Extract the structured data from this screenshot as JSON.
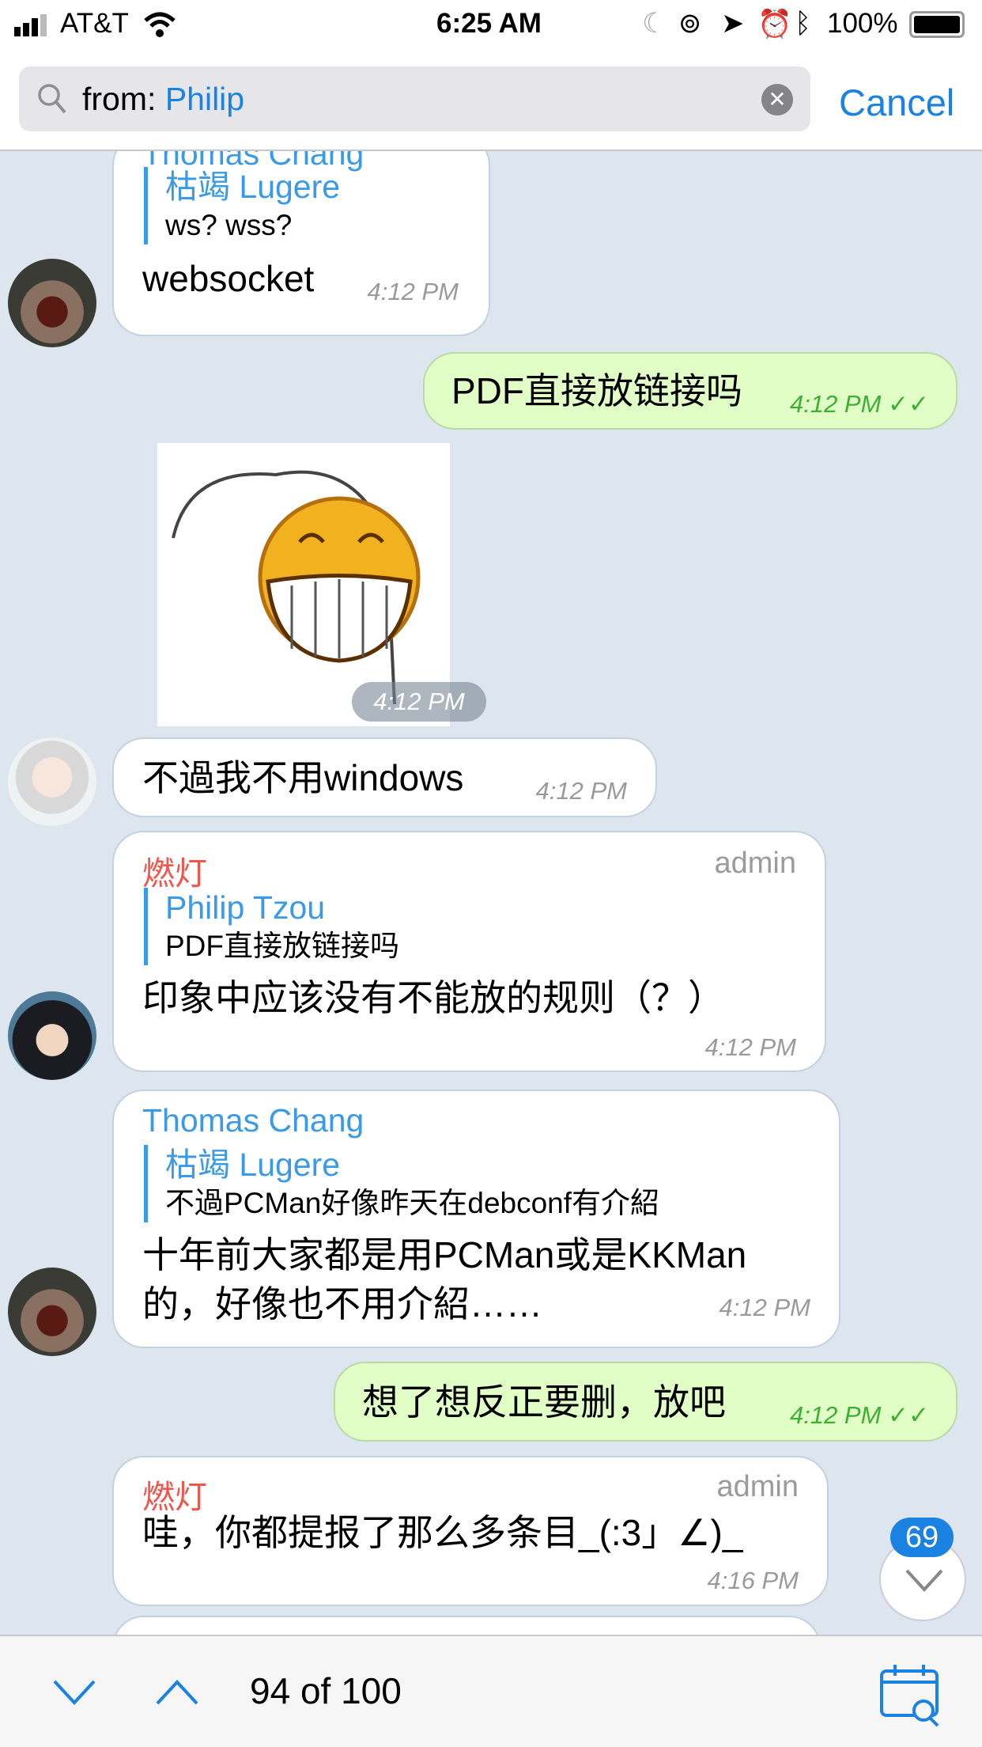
{
  "status_bar": {
    "carrier": "AT&T",
    "time": "6:25 AM",
    "battery": "100%",
    "icons": [
      "signal-icon",
      "wifi-icon",
      "moon-icon",
      "rotation-lock-icon",
      "location-icon",
      "alarm-icon",
      "bluetooth-icon",
      "battery-icon"
    ]
  },
  "search": {
    "prefix": "from:",
    "query": "Philip",
    "cancel": "Cancel"
  },
  "messages": [
    {
      "sender": "Thomas Chang",
      "reply_name": "枯竭 Lugere",
      "reply_text": "ws? wss?",
      "text": "websocket",
      "time": "4:12 PM"
    },
    {
      "text": "PDF直接放链接吗",
      "time": "4:12 PM",
      "outgoing": true
    },
    {
      "sticker": "grinning-face-sticker",
      "time": "4:12 PM"
    },
    {
      "text": "不過我不用windows",
      "time": "4:12 PM"
    },
    {
      "sender": "燃灯",
      "role": "admin",
      "reply_name": "Philip Tzou",
      "reply_text": "PDF直接放链接吗",
      "text": "印象中应该没有不能放的规则（？）",
      "time": "4:12 PM"
    },
    {
      "sender": "Thomas Chang",
      "reply_name": "枯竭 Lugere",
      "reply_text": "不過PCMan好像昨天在debconf有介紹",
      "text": "十年前大家都是用PCMan或是KKMan",
      "text2": "的，好像也不用介紹……",
      "time": "4:12 PM"
    },
    {
      "text": "想了想反正要删，放吧",
      "time": "4:12 PM",
      "outgoing": true
    },
    {
      "sender": "燃灯",
      "role": "admin",
      "text": "哇，你都提报了那么多条目_(:3」∠)_",
      "time": "4:16 PM"
    }
  ],
  "scroll_badge": "69",
  "bottom_bar": {
    "counter": "94 of 100"
  },
  "colors": {
    "accent": "#1a82e2",
    "outgoing_bubble": "#e1fec7",
    "admin_name": "#f2554c",
    "link_name": "#3a9ae8"
  }
}
